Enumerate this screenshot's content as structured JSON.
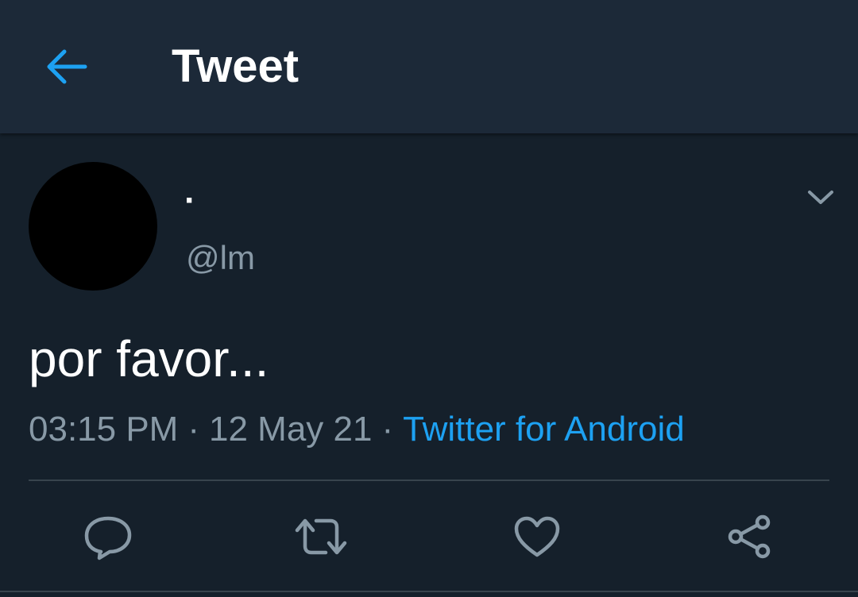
{
  "header": {
    "title": "Tweet",
    "back_icon": "arrow-left-icon"
  },
  "tweet": {
    "author": {
      "display_name": "·",
      "handle": "@lm"
    },
    "text": "por favor...",
    "time": "03:15 PM",
    "date": "12 May 21",
    "separator": "·",
    "source": "Twitter for Android",
    "menu_icon": "chevron-down-icon"
  },
  "actions": [
    {
      "name": "reply",
      "icon": "reply-icon"
    },
    {
      "name": "retweet",
      "icon": "retweet-icon"
    },
    {
      "name": "like",
      "icon": "heart-icon"
    },
    {
      "name": "share",
      "icon": "share-icon"
    }
  ],
  "colors": {
    "background": "#15202b",
    "header": "#1c2938",
    "accent": "#1da1f2",
    "muted": "#8899a6",
    "divider": "#38444d"
  }
}
